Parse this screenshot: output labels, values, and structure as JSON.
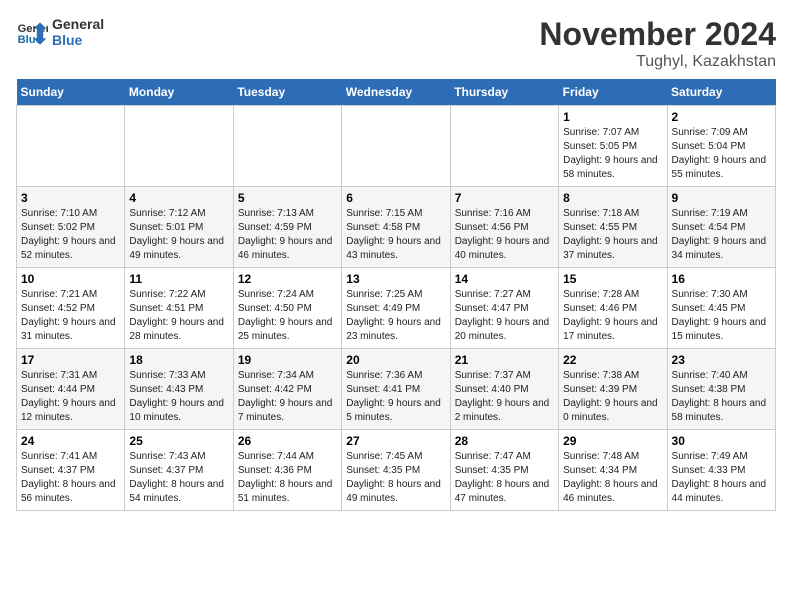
{
  "logo": {
    "line1": "General",
    "line2": "Blue"
  },
  "title": "November 2024",
  "location": "Tughyl, Kazakhstan",
  "weekdays": [
    "Sunday",
    "Monday",
    "Tuesday",
    "Wednesday",
    "Thursday",
    "Friday",
    "Saturday"
  ],
  "weeks": [
    [
      {
        "day": "",
        "info": ""
      },
      {
        "day": "",
        "info": ""
      },
      {
        "day": "",
        "info": ""
      },
      {
        "day": "",
        "info": ""
      },
      {
        "day": "",
        "info": ""
      },
      {
        "day": "1",
        "info": "Sunrise: 7:07 AM\nSunset: 5:05 PM\nDaylight: 9 hours and 58 minutes."
      },
      {
        "day": "2",
        "info": "Sunrise: 7:09 AM\nSunset: 5:04 PM\nDaylight: 9 hours and 55 minutes."
      }
    ],
    [
      {
        "day": "3",
        "info": "Sunrise: 7:10 AM\nSunset: 5:02 PM\nDaylight: 9 hours and 52 minutes."
      },
      {
        "day": "4",
        "info": "Sunrise: 7:12 AM\nSunset: 5:01 PM\nDaylight: 9 hours and 49 minutes."
      },
      {
        "day": "5",
        "info": "Sunrise: 7:13 AM\nSunset: 4:59 PM\nDaylight: 9 hours and 46 minutes."
      },
      {
        "day": "6",
        "info": "Sunrise: 7:15 AM\nSunset: 4:58 PM\nDaylight: 9 hours and 43 minutes."
      },
      {
        "day": "7",
        "info": "Sunrise: 7:16 AM\nSunset: 4:56 PM\nDaylight: 9 hours and 40 minutes."
      },
      {
        "day": "8",
        "info": "Sunrise: 7:18 AM\nSunset: 4:55 PM\nDaylight: 9 hours and 37 minutes."
      },
      {
        "day": "9",
        "info": "Sunrise: 7:19 AM\nSunset: 4:54 PM\nDaylight: 9 hours and 34 minutes."
      }
    ],
    [
      {
        "day": "10",
        "info": "Sunrise: 7:21 AM\nSunset: 4:52 PM\nDaylight: 9 hours and 31 minutes."
      },
      {
        "day": "11",
        "info": "Sunrise: 7:22 AM\nSunset: 4:51 PM\nDaylight: 9 hours and 28 minutes."
      },
      {
        "day": "12",
        "info": "Sunrise: 7:24 AM\nSunset: 4:50 PM\nDaylight: 9 hours and 25 minutes."
      },
      {
        "day": "13",
        "info": "Sunrise: 7:25 AM\nSunset: 4:49 PM\nDaylight: 9 hours and 23 minutes."
      },
      {
        "day": "14",
        "info": "Sunrise: 7:27 AM\nSunset: 4:47 PM\nDaylight: 9 hours and 20 minutes."
      },
      {
        "day": "15",
        "info": "Sunrise: 7:28 AM\nSunset: 4:46 PM\nDaylight: 9 hours and 17 minutes."
      },
      {
        "day": "16",
        "info": "Sunrise: 7:30 AM\nSunset: 4:45 PM\nDaylight: 9 hours and 15 minutes."
      }
    ],
    [
      {
        "day": "17",
        "info": "Sunrise: 7:31 AM\nSunset: 4:44 PM\nDaylight: 9 hours and 12 minutes."
      },
      {
        "day": "18",
        "info": "Sunrise: 7:33 AM\nSunset: 4:43 PM\nDaylight: 9 hours and 10 minutes."
      },
      {
        "day": "19",
        "info": "Sunrise: 7:34 AM\nSunset: 4:42 PM\nDaylight: 9 hours and 7 minutes."
      },
      {
        "day": "20",
        "info": "Sunrise: 7:36 AM\nSunset: 4:41 PM\nDaylight: 9 hours and 5 minutes."
      },
      {
        "day": "21",
        "info": "Sunrise: 7:37 AM\nSunset: 4:40 PM\nDaylight: 9 hours and 2 minutes."
      },
      {
        "day": "22",
        "info": "Sunrise: 7:38 AM\nSunset: 4:39 PM\nDaylight: 9 hours and 0 minutes."
      },
      {
        "day": "23",
        "info": "Sunrise: 7:40 AM\nSunset: 4:38 PM\nDaylight: 8 hours and 58 minutes."
      }
    ],
    [
      {
        "day": "24",
        "info": "Sunrise: 7:41 AM\nSunset: 4:37 PM\nDaylight: 8 hours and 56 minutes."
      },
      {
        "day": "25",
        "info": "Sunrise: 7:43 AM\nSunset: 4:37 PM\nDaylight: 8 hours and 54 minutes."
      },
      {
        "day": "26",
        "info": "Sunrise: 7:44 AM\nSunset: 4:36 PM\nDaylight: 8 hours and 51 minutes."
      },
      {
        "day": "27",
        "info": "Sunrise: 7:45 AM\nSunset: 4:35 PM\nDaylight: 8 hours and 49 minutes."
      },
      {
        "day": "28",
        "info": "Sunrise: 7:47 AM\nSunset: 4:35 PM\nDaylight: 8 hours and 47 minutes."
      },
      {
        "day": "29",
        "info": "Sunrise: 7:48 AM\nSunset: 4:34 PM\nDaylight: 8 hours and 46 minutes."
      },
      {
        "day": "30",
        "info": "Sunrise: 7:49 AM\nSunset: 4:33 PM\nDaylight: 8 hours and 44 minutes."
      }
    ]
  ]
}
